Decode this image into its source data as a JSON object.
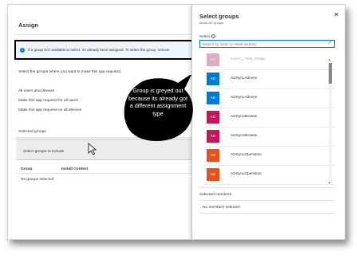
{
  "assign": {
    "title": "Assign",
    "info_text": "If a group isn't available to select, it's already been assigned. To select the group, remove",
    "description": "Select the groups where you want to make this app required.",
    "options": [
      "All users and devices",
      "Make this app required for all users",
      "Make this app required on all devices"
    ],
    "selected_groups_label": "Selected groups",
    "select_groups_button": "Select groups to include",
    "table_columns": [
      "Group",
      "Install Context"
    ],
    "empty_text": "No groups selected"
  },
  "callout": {
    "text": "Group is greyed out because its already got a different assignment type"
  },
  "select_groups": {
    "title": "Select groups",
    "subtitle": "Azure AD groups",
    "select_label": "Select",
    "search_placeholder": "Search by name or email address",
    "groups": [
      {
        "initials": "AA",
        "name": "AAAA__Test_Group",
        "color": "#c46b93",
        "disabled": true
      },
      {
        "initials": "AD",
        "name": "ADSyncAdmins",
        "color": "#0078d4",
        "disabled": false
      },
      {
        "initials": "AD",
        "name": "ADSyncAdmins",
        "color": "#0078d4",
        "disabled": false
      },
      {
        "initials": "AD",
        "name": "ADSyncBrowse",
        "color": "#c2185b",
        "disabled": false
      },
      {
        "initials": "AD",
        "name": "ADSyncBrowse",
        "color": "#c2185b",
        "disabled": false
      },
      {
        "initials": "AD",
        "name": "ADSyncOperators",
        "color": "#e2531f",
        "disabled": false
      },
      {
        "initials": "AD",
        "name": "ADSyncOperators",
        "color": "#e2531f",
        "disabled": false
      }
    ],
    "selected_members_label": "Selected members:",
    "no_members_text": "No members selected"
  }
}
